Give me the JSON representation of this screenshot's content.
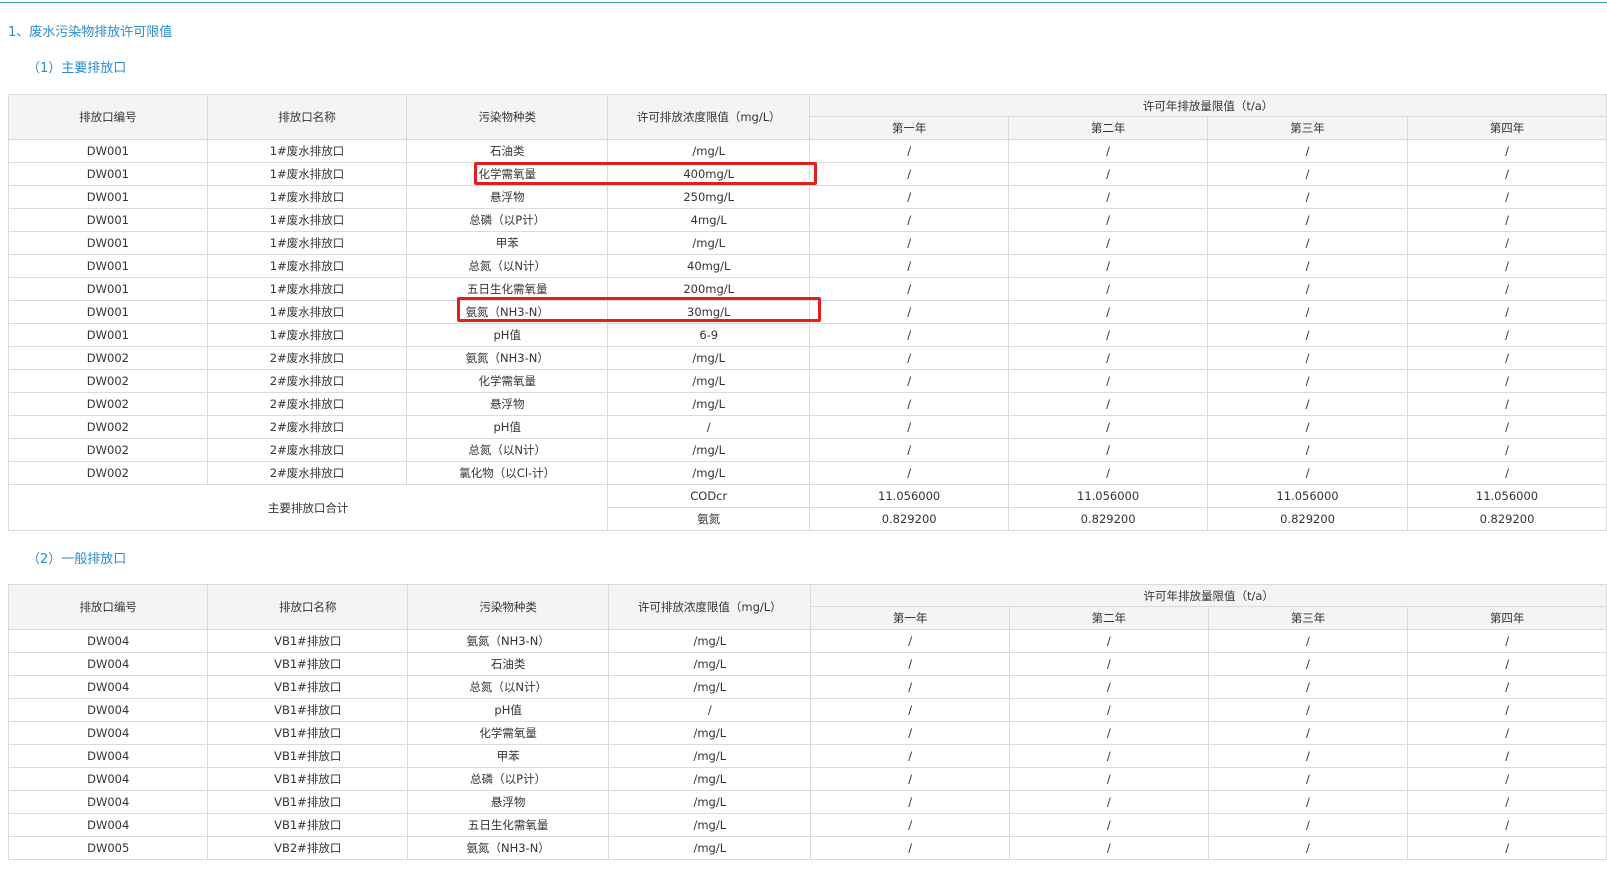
{
  "section_title": "1、废水污染物排放许可限值",
  "main_outlets": {
    "subtitle": "（1）主要排放口",
    "headers": {
      "outlet_id": "排放口编号",
      "outlet_name": "排放口名称",
      "pollutant": "污染物种类",
      "concentration": "许可排放浓度限值（mg/L）",
      "annual_group": "许可年排放量限值（t/a）",
      "years": [
        "第一年",
        "第二年",
        "第三年",
        "第四年"
      ]
    },
    "rows": [
      {
        "id": "DW001",
        "name": "1#废水排放口",
        "pollutant": "石油类",
        "limit": "/mg/L",
        "years": [
          "/",
          "/",
          "/",
          "/"
        ]
      },
      {
        "id": "DW001",
        "name": "1#废水排放口",
        "pollutant": "化学需氧量",
        "limit": "400mg/L",
        "years": [
          "/",
          "/",
          "/",
          "/"
        ]
      },
      {
        "id": "DW001",
        "name": "1#废水排放口",
        "pollutant": "悬浮物",
        "limit": "250mg/L",
        "years": [
          "/",
          "/",
          "/",
          "/"
        ]
      },
      {
        "id": "DW001",
        "name": "1#废水排放口",
        "pollutant": "总磷（以P计）",
        "limit": "4mg/L",
        "years": [
          "/",
          "/",
          "/",
          "/"
        ]
      },
      {
        "id": "DW001",
        "name": "1#废水排放口",
        "pollutant": "甲苯",
        "limit": "/mg/L",
        "years": [
          "/",
          "/",
          "/",
          "/"
        ]
      },
      {
        "id": "DW001",
        "name": "1#废水排放口",
        "pollutant": "总氮（以N计）",
        "limit": "40mg/L",
        "years": [
          "/",
          "/",
          "/",
          "/"
        ]
      },
      {
        "id": "DW001",
        "name": "1#废水排放口",
        "pollutant": "五日生化需氧量",
        "limit": "200mg/L",
        "years": [
          "/",
          "/",
          "/",
          "/"
        ]
      },
      {
        "id": "DW001",
        "name": "1#废水排放口",
        "pollutant": "氨氮（NH3-N）",
        "limit": "30mg/L",
        "years": [
          "/",
          "/",
          "/",
          "/"
        ]
      },
      {
        "id": "DW001",
        "name": "1#废水排放口",
        "pollutant": "pH值",
        "limit": "6-9",
        "years": [
          "/",
          "/",
          "/",
          "/"
        ]
      },
      {
        "id": "DW002",
        "name": "2#废水排放口",
        "pollutant": "氨氮（NH3-N）",
        "limit": "/mg/L",
        "years": [
          "/",
          "/",
          "/",
          "/"
        ]
      },
      {
        "id": "DW002",
        "name": "2#废水排放口",
        "pollutant": "化学需氧量",
        "limit": "/mg/L",
        "years": [
          "/",
          "/",
          "/",
          "/"
        ]
      },
      {
        "id": "DW002",
        "name": "2#废水排放口",
        "pollutant": "悬浮物",
        "limit": "/mg/L",
        "years": [
          "/",
          "/",
          "/",
          "/"
        ]
      },
      {
        "id": "DW002",
        "name": "2#废水排放口",
        "pollutant": "pH值",
        "limit": "/",
        "years": [
          "/",
          "/",
          "/",
          "/"
        ]
      },
      {
        "id": "DW002",
        "name": "2#废水排放口",
        "pollutant": "总氮（以N计）",
        "limit": "/mg/L",
        "years": [
          "/",
          "/",
          "/",
          "/"
        ]
      },
      {
        "id": "DW002",
        "name": "2#废水排放口",
        "pollutant": "氯化物（以Cl-计）",
        "limit": "/mg/L",
        "years": [
          "/",
          "/",
          "/",
          "/"
        ]
      }
    ],
    "summary": {
      "label": "主要排放口合计",
      "rows": [
        {
          "pollutant": "CODcr",
          "years": [
            "11.056000",
            "11.056000",
            "11.056000",
            "11.056000"
          ]
        },
        {
          "pollutant": "氨氮",
          "years": [
            "0.829200",
            "0.829200",
            "0.829200",
            "0.829200"
          ]
        }
      ]
    }
  },
  "general_outlets": {
    "subtitle": "（2）一般排放口",
    "headers": {
      "outlet_id": "排放口编号",
      "outlet_name": "排放口名称",
      "pollutant": "污染物种类",
      "concentration": "许可排放浓度限值（mg/L）",
      "annual_group": "许可年排放量限值（t/a）",
      "years": [
        "第一年",
        "第二年",
        "第三年",
        "第四年"
      ]
    },
    "rows": [
      {
        "id": "DW004",
        "name": "VB1#排放口",
        "pollutant": "氨氮（NH3-N）",
        "limit": "/mg/L",
        "years": [
          "/",
          "/",
          "/",
          "/"
        ]
      },
      {
        "id": "DW004",
        "name": "VB1#排放口",
        "pollutant": "石油类",
        "limit": "/mg/L",
        "years": [
          "/",
          "/",
          "/",
          "/"
        ]
      },
      {
        "id": "DW004",
        "name": "VB1#排放口",
        "pollutant": "总氮（以N计）",
        "limit": "/mg/L",
        "years": [
          "/",
          "/",
          "/",
          "/"
        ]
      },
      {
        "id": "DW004",
        "name": "VB1#排放口",
        "pollutant": "pH值",
        "limit": "/",
        "years": [
          "/",
          "/",
          "/",
          "/"
        ]
      },
      {
        "id": "DW004",
        "name": "VB1#排放口",
        "pollutant": "化学需氧量",
        "limit": "/mg/L",
        "years": [
          "/",
          "/",
          "/",
          "/"
        ]
      },
      {
        "id": "DW004",
        "name": "VB1#排放口",
        "pollutant": "甲苯",
        "limit": "/mg/L",
        "years": [
          "/",
          "/",
          "/",
          "/"
        ]
      },
      {
        "id": "DW004",
        "name": "VB1#排放口",
        "pollutant": "总磷（以P计）",
        "limit": "/mg/L",
        "years": [
          "/",
          "/",
          "/",
          "/"
        ]
      },
      {
        "id": "DW004",
        "name": "VB1#排放口",
        "pollutant": "悬浮物",
        "limit": "/mg/L",
        "years": [
          "/",
          "/",
          "/",
          "/"
        ]
      },
      {
        "id": "DW004",
        "name": "VB1#排放口",
        "pollutant": "五日生化需氧量",
        "limit": "/mg/L",
        "years": [
          "/",
          "/",
          "/",
          "/"
        ]
      },
      {
        "id": "DW005",
        "name": "VB2#排放口",
        "pollutant": "氨氮（NH3-N）",
        "limit": "/mg/L",
        "years": [
          "/",
          "/",
          "/",
          "/"
        ]
      }
    ]
  },
  "colors": {
    "accent": "#2a8bd0",
    "highlight": "#e0201c",
    "header_bg": "#f4f4f4",
    "border": "#dadada"
  }
}
